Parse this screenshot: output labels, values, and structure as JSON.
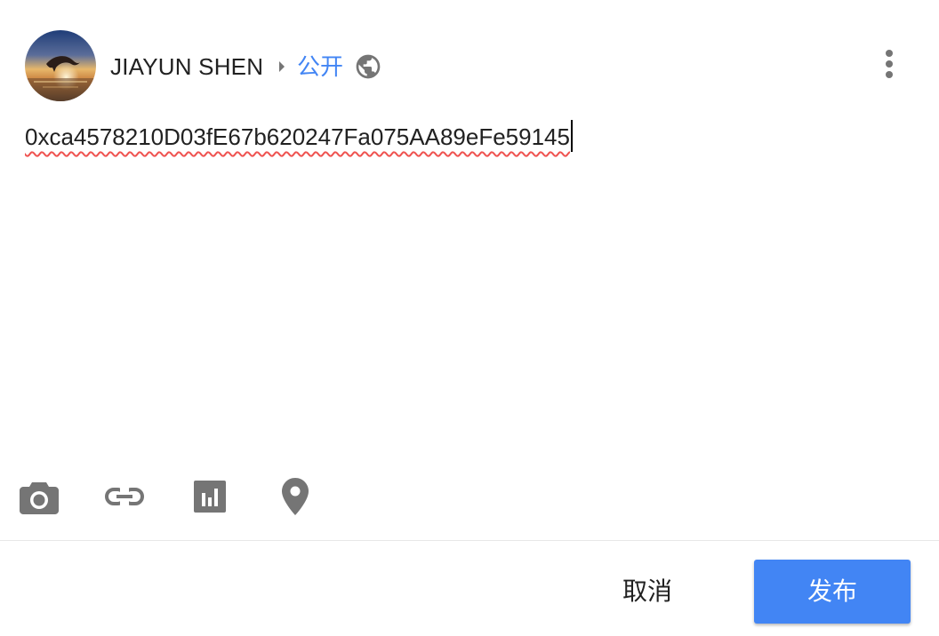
{
  "header": {
    "author_name": "JIAYUN SHEN",
    "visibility_label": "公开",
    "icons": {
      "avatar": "avatar-dolphin-sunset",
      "arrow": "arrow-right-icon",
      "visibility": "globe-icon",
      "menu": "more-vert-icon"
    }
  },
  "compose": {
    "text": "0xca4578210D03fE67b620247Fa075AA89eFe59145"
  },
  "toolbar": {
    "items": [
      {
        "icon": "camera-icon"
      },
      {
        "icon": "link-icon"
      },
      {
        "icon": "poll-chart-icon"
      },
      {
        "icon": "location-pin-icon"
      }
    ]
  },
  "footer": {
    "cancel_label": "取消",
    "publish_label": "发布"
  },
  "colors": {
    "accent": "#4285f4",
    "text": "#212121",
    "icon": "#757575",
    "spellcheck": "#ef5350"
  }
}
